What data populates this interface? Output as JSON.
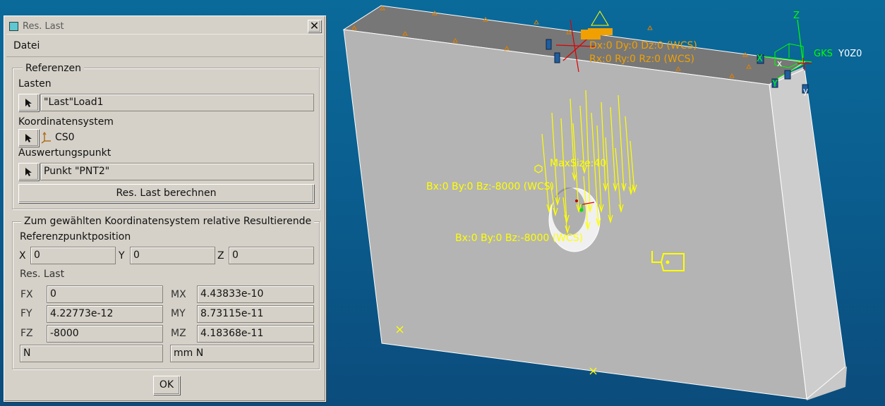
{
  "dialog": {
    "title": "Res. Last",
    "close_label": "✕",
    "menu": [
      "Datei"
    ],
    "references": {
      "legend": "Referenzen",
      "loads_label": "Lasten",
      "loads_value": "\"Last\"Load1",
      "cs_label": "Koordinatensystem",
      "cs_value": "CS0",
      "point_label": "Auswertungspunkt",
      "point_value": "Punkt \"PNT2\"",
      "compute_button": "Res. Last berechnen"
    },
    "result": {
      "legend": "Zum gewählten Koordinatensystem relative Resultierende",
      "ref_pos_label": "Referenzpunktposition",
      "x_label": "X",
      "x_value": "0",
      "y_label": "Y",
      "y_value": "0",
      "z_label": "Z",
      "z_value": "0",
      "res_label": "Res. Last",
      "fx_label": "FX",
      "fx_value": "0",
      "fy_label": "FY",
      "fy_value": "4.22773e-12",
      "fz_label": "FZ",
      "fz_value": "-8000",
      "mx_label": "MX",
      "mx_value": "4.43833e-10",
      "my_label": "MY",
      "my_value": "8.73115e-11",
      "mz_label": "MZ",
      "mz_value": "4.18368e-11",
      "force_unit": "N",
      "moment_unit": "mm N"
    },
    "ok_button": "OK"
  },
  "viewport": {
    "constraint_line1": "Dx:0 Dy:0 Dz:0 (WCS)",
    "constraint_line2": "Rx:0 Ry:0 Rz:0 (WCS)",
    "load_label_top": "Bx:0 By:0 Bz:-8000 (WCS)",
    "load_label_bottom": "Bx:0 By:0 Bz:-8000 (WCS)",
    "mesh_label": "MaxSize:40",
    "csys_name": "GKS",
    "view_name": "Y0Z0",
    "axis_x": "X",
    "axis_y": "Y",
    "axis_z": "Z",
    "axis_small_x": "x",
    "axis_small_y": "y",
    "colors": {
      "background_top": "#0a6a9a",
      "background_bottom": "#0b4c7c",
      "annotation_yellow": "#ffff00",
      "constraint_orange": "#f0a000",
      "csys_green": "#00ff00",
      "constraint_red": "#e00000"
    }
  }
}
